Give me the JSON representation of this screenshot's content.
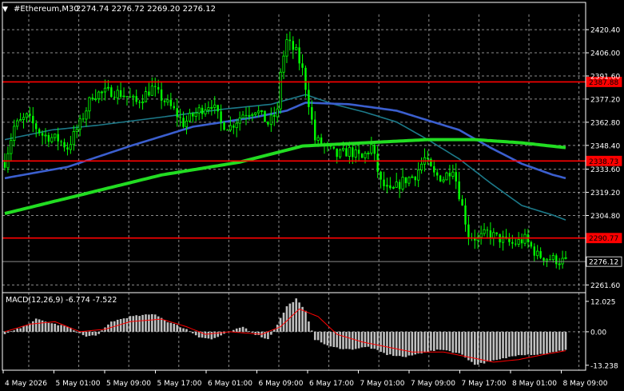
{
  "header": {
    "symbol": "#Ethereum,M30",
    "ohlc": "2274.74 2276.72 2269.20 2276.12",
    "arrow": "▼"
  },
  "colors": {
    "background": "#000000",
    "candle": "#00ff00",
    "grid": "#ffffff",
    "sma_slow": "#22dd22",
    "sma_mid": "#3b5fcf",
    "sma_fast": "#1c7a8a",
    "hline": "#ff0000",
    "macd_hist": "#c0c0c0",
    "macd_signal": "#ff0000",
    "text": "#ffffff"
  },
  "price_axis": {
    "ticks": [
      {
        "v": 2420.4,
        "label": "2420.40"
      },
      {
        "v": 2406.0,
        "label": "2406.00"
      },
      {
        "v": 2391.6,
        "label": "2391.60"
      },
      {
        "v": 2377.2,
        "label": "2377.20"
      },
      {
        "v": 2362.8,
        "label": "2362.80"
      },
      {
        "v": 2348.4,
        "label": "2348.40"
      },
      {
        "v": 2333.6,
        "label": "2333.60"
      },
      {
        "v": 2319.2,
        "label": "2319.20"
      },
      {
        "v": 2304.8,
        "label": "2304.80"
      },
      {
        "v": 2261.6,
        "label": "2261.60"
      }
    ],
    "range": [
      2257.8,
      2427.9
    ]
  },
  "levels": [
    {
      "v": 2387.88,
      "label": "2387.88",
      "color": "#ff0000"
    },
    {
      "v": 2338.73,
      "label": "2338.73",
      "color": "#ff0000"
    },
    {
      "v": 2290.77,
      "label": "2290.77",
      "color": "#ff0000"
    },
    {
      "v": 2276.12,
      "label": "2276.12",
      "color": "#000000",
      "line": "#8a8a8a"
    }
  ],
  "time_axis": {
    "labels": [
      "4 May 2026",
      "5 May 01:00",
      "5 May 09:00",
      "5 May 17:00",
      "6 May 01:00",
      "6 May 09:00",
      "6 May 17:00",
      "7 May 01:00",
      "7 May 09:00",
      "7 May 17:00",
      "8 May 01:00",
      "8 May 09:00"
    ]
  },
  "macd": {
    "label": "MACD(12,26,9) -6.774 -7.522",
    "ticks": [
      {
        "v": 12.025,
        "label": "12.025"
      },
      {
        "v": 0,
        "label": "0.00"
      },
      {
        "v": -13.238,
        "label": "-13.238"
      }
    ],
    "range": [
      -15.2,
      14.2
    ]
  },
  "chart_data": {
    "type": "candlestick",
    "bars": 180,
    "price_path": [
      [
        0,
        2338
      ],
      [
        3,
        2360
      ],
      [
        7,
        2366
      ],
      [
        12,
        2355
      ],
      [
        17,
        2352
      ],
      [
        20,
        2347
      ],
      [
        24,
        2362
      ],
      [
        28,
        2380
      ],
      [
        34,
        2382
      ],
      [
        38,
        2380
      ],
      [
        42,
        2375
      ],
      [
        47,
        2384
      ],
      [
        50,
        2378
      ],
      [
        54,
        2370
      ],
      [
        57,
        2362
      ],
      [
        62,
        2370
      ],
      [
        66,
        2375
      ],
      [
        69,
        2362
      ],
      [
        72,
        2360
      ],
      [
        76,
        2368
      ],
      [
        80,
        2371
      ],
      [
        84,
        2362
      ],
      [
        87,
        2369
      ],
      [
        88,
        2395
      ],
      [
        90,
        2413
      ],
      [
        93,
        2406
      ],
      [
        95,
        2395
      ],
      [
        97,
        2375
      ],
      [
        99,
        2352
      ],
      [
        102,
        2348
      ],
      [
        106,
        2342
      ],
      [
        110,
        2345
      ],
      [
        114,
        2340
      ],
      [
        117,
        2348
      ],
      [
        120,
        2325
      ],
      [
        123,
        2319
      ],
      [
        127,
        2326
      ],
      [
        131,
        2330
      ],
      [
        134,
        2340
      ],
      [
        137,
        2330
      ],
      [
        140,
        2328
      ],
      [
        143,
        2335
      ],
      [
        146,
        2310
      ],
      [
        148,
        2293
      ],
      [
        151,
        2290
      ],
      [
        154,
        2294
      ],
      [
        157,
        2291
      ],
      [
        162,
        2287
      ],
      [
        166,
        2290
      ],
      [
        170,
        2280
      ],
      [
        174,
        2278
      ],
      [
        179,
        2276
      ]
    ],
    "sma_fast": [
      [
        0,
        2352
      ],
      [
        15,
        2358
      ],
      [
        30,
        2361
      ],
      [
        50,
        2366
      ],
      [
        70,
        2371
      ],
      [
        85,
        2374
      ],
      [
        96,
        2380
      ],
      [
        105,
        2374
      ],
      [
        115,
        2369
      ],
      [
        125,
        2363
      ],
      [
        135,
        2352
      ],
      [
        145,
        2340
      ],
      [
        155,
        2325
      ],
      [
        165,
        2311
      ],
      [
        175,
        2305
      ],
      [
        179,
        2302
      ]
    ],
    "sma_mid": [
      [
        0,
        2328
      ],
      [
        20,
        2335
      ],
      [
        40,
        2348
      ],
      [
        60,
        2360
      ],
      [
        80,
        2366
      ],
      [
        90,
        2370
      ],
      [
        96,
        2375
      ],
      [
        110,
        2374
      ],
      [
        125,
        2370
      ],
      [
        135,
        2364
      ],
      [
        145,
        2358
      ],
      [
        155,
        2347
      ],
      [
        165,
        2337
      ],
      [
        175,
        2330
      ],
      [
        179,
        2328
      ]
    ],
    "sma_slow": [
      [
        0,
        2306
      ],
      [
        25,
        2318
      ],
      [
        50,
        2330
      ],
      [
        75,
        2338
      ],
      [
        95,
        2348
      ],
      [
        115,
        2350
      ],
      [
        135,
        2352
      ],
      [
        150,
        2352
      ],
      [
        165,
        2350
      ],
      [
        179,
        2347
      ]
    ],
    "macd_hist": [
      [
        0,
        -1
      ],
      [
        6,
        2
      ],
      [
        10,
        5
      ],
      [
        16,
        3
      ],
      [
        20,
        2
      ],
      [
        26,
        -2
      ],
      [
        30,
        -1
      ],
      [
        34,
        4
      ],
      [
        40,
        6
      ],
      [
        48,
        7
      ],
      [
        52,
        4
      ],
      [
        58,
        1
      ],
      [
        62,
        -2
      ],
      [
        66,
        -3
      ],
      [
        70,
        -1
      ],
      [
        76,
        2
      ],
      [
        80,
        -1
      ],
      [
        84,
        -3
      ],
      [
        87,
        3
      ],
      [
        90,
        10
      ],
      [
        93,
        13
      ],
      [
        96,
        8
      ],
      [
        99,
        -3
      ],
      [
        104,
        -6
      ],
      [
        110,
        -7
      ],
      [
        116,
        -6
      ],
      [
        122,
        -9
      ],
      [
        128,
        -10
      ],
      [
        134,
        -8
      ],
      [
        140,
        -7
      ],
      [
        146,
        -9
      ],
      [
        150,
        -13
      ],
      [
        154,
        -12
      ],
      [
        158,
        -11
      ],
      [
        164,
        -9
      ],
      [
        170,
        -9
      ],
      [
        176,
        -8
      ],
      [
        179,
        -7
      ]
    ],
    "macd_signal": [
      [
        0,
        0
      ],
      [
        8,
        3
      ],
      [
        16,
        4
      ],
      [
        24,
        0
      ],
      [
        32,
        1
      ],
      [
        40,
        4
      ],
      [
        50,
        5
      ],
      [
        58,
        2
      ],
      [
        64,
        -1
      ],
      [
        72,
        0
      ],
      [
        82,
        -1
      ],
      [
        88,
        2
      ],
      [
        94,
        9
      ],
      [
        100,
        6
      ],
      [
        106,
        -1
      ],
      [
        114,
        -4
      ],
      [
        122,
        -6
      ],
      [
        130,
        -8
      ],
      [
        140,
        -8
      ],
      [
        148,
        -10
      ],
      [
        156,
        -12
      ],
      [
        164,
        -11
      ],
      [
        172,
        -9
      ],
      [
        179,
        -7.5
      ]
    ]
  }
}
